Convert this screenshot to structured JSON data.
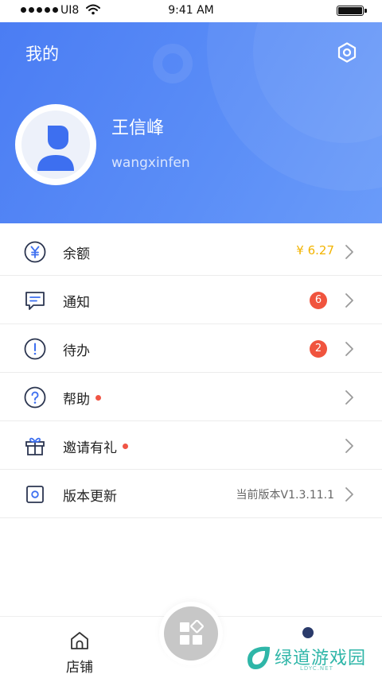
{
  "status_bar": {
    "carrier": "UI8",
    "time": "9:41 AM"
  },
  "header": {
    "title": "我的",
    "settings_icon": "settings-hexagon-icon"
  },
  "profile": {
    "name": "王信峰",
    "username": "wangxinfen",
    "avatar_icon": "user-avatar-icon"
  },
  "menu": [
    {
      "label": "余额",
      "icon": "yuan-coin-icon",
      "value": "¥ 6.27",
      "value_color": "#f3b400"
    },
    {
      "label": "通知",
      "icon": "message-icon",
      "badge": "6",
      "badge_color": "#f0543e"
    },
    {
      "label": "待办",
      "icon": "exclamation-circle-icon",
      "badge": "2",
      "badge_color": "#f0543e"
    },
    {
      "label": "帮助",
      "icon": "question-circle-icon",
      "has_dot": true
    },
    {
      "label": "邀请有礼",
      "icon": "gift-icon",
      "has_dot": true
    },
    {
      "label": "版本更新",
      "icon": "update-box-icon",
      "value": "当前版本V1.3.11.1"
    }
  ],
  "tabbar": {
    "store_label": "店铺",
    "store_icon": "home-icon",
    "center_icon": "apps-grid-icon"
  },
  "watermark": {
    "text": "绿道游戏园",
    "sub": "LDYC.NET"
  },
  "colors": {
    "brand_blue": "#4a7cf3",
    "badge_red": "#f0543e",
    "money_gold": "#f3b400"
  }
}
